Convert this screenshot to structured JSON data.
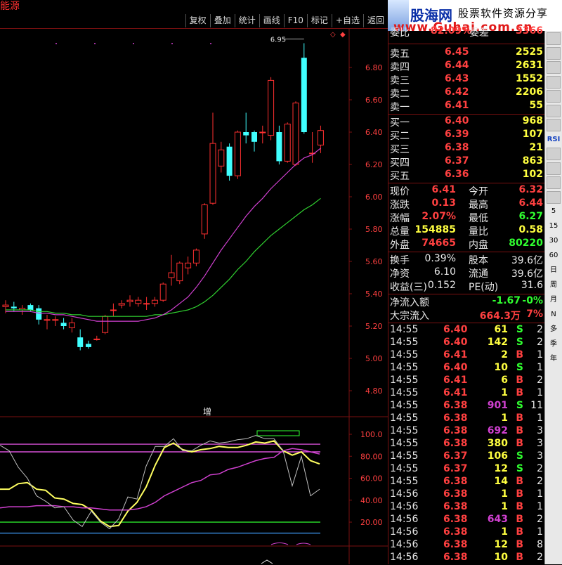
{
  "window": {
    "title": "能源"
  },
  "toolbar": [
    {
      "label": "复权"
    },
    {
      "label": "叠加"
    },
    {
      "label": "统计"
    },
    {
      "label": "画线"
    },
    {
      "label": "F10"
    },
    {
      "label": "标记"
    },
    {
      "label": "+自选"
    },
    {
      "label": "返回"
    }
  ],
  "ad": {
    "logo": "股海网",
    "slogan": "股票软件资源分享",
    "url": "www.Guhai.com.cn"
  },
  "main_chart": {
    "y_axis_ticks": [
      "6.80",
      "6.60",
      "6.40",
      "6.20",
      "6.00",
      "5.80",
      "5.60",
      "5.40",
      "5.20",
      "5.00",
      "4.80"
    ],
    "high_label": "6.95",
    "mark_label": "增",
    "up_color": "#ff3030",
    "down_color": "#40ffff",
    "ma_short_color": "#d040d0",
    "ma_long_color": "#30d030",
    "ma_mid_color": "#e8e8e8"
  },
  "indicator": {
    "y_axis_ticks": [
      "100.0",
      "80.00",
      "60.00",
      "40.00",
      "20.00"
    ]
  },
  "chart_data": [
    {
      "type": "candlestick",
      "title": "",
      "ylim": [
        4.7,
        7.0
      ],
      "candles": [
        {
          "o": 5.32,
          "h": 5.36,
          "l": 5.28,
          "c": 5.33
        },
        {
          "o": 5.32,
          "h": 5.35,
          "l": 5.29,
          "c": 5.31
        },
        {
          "o": 5.3,
          "h": 5.33,
          "l": 5.27,
          "c": 5.31
        },
        {
          "o": 5.33,
          "h": 5.34,
          "l": 5.29,
          "c": 5.3
        },
        {
          "o": 5.31,
          "h": 5.33,
          "l": 5.21,
          "c": 5.24
        },
        {
          "o": 5.24,
          "h": 5.27,
          "l": 5.18,
          "c": 5.24
        },
        {
          "o": 5.24,
          "h": 5.26,
          "l": 5.2,
          "c": 5.24
        },
        {
          "o": 5.22,
          "h": 5.25,
          "l": 5.18,
          "c": 5.2
        },
        {
          "o": 5.19,
          "h": 5.25,
          "l": 5.16,
          "c": 5.22
        },
        {
          "o": 5.13,
          "h": 5.18,
          "l": 5.05,
          "c": 5.07
        },
        {
          "o": 5.09,
          "h": 5.11,
          "l": 5.06,
          "c": 5.07
        },
        {
          "o": 5.12,
          "h": 5.14,
          "l": 5.11,
          "c": 5.12
        },
        {
          "o": 5.16,
          "h": 5.27,
          "l": 5.15,
          "c": 5.26
        },
        {
          "o": 5.3,
          "h": 5.34,
          "l": 5.26,
          "c": 5.3
        },
        {
          "o": 5.33,
          "h": 5.36,
          "l": 5.31,
          "c": 5.34
        },
        {
          "o": 5.35,
          "h": 5.39,
          "l": 5.32,
          "c": 5.36
        },
        {
          "o": 5.34,
          "h": 5.38,
          "l": 5.32,
          "c": 5.36
        },
        {
          "o": 5.34,
          "h": 5.38,
          "l": 5.3,
          "c": 5.34
        },
        {
          "o": 5.34,
          "h": 5.38,
          "l": 5.32,
          "c": 5.36
        },
        {
          "o": 5.36,
          "h": 5.47,
          "l": 5.35,
          "c": 5.46
        },
        {
          "o": 5.5,
          "h": 5.64,
          "l": 5.45,
          "c": 5.53
        },
        {
          "o": 5.48,
          "h": 5.6,
          "l": 5.46,
          "c": 5.59
        },
        {
          "o": 5.56,
          "h": 5.63,
          "l": 5.52,
          "c": 5.59
        },
        {
          "o": 5.59,
          "h": 5.68,
          "l": 5.57,
          "c": 5.67
        },
        {
          "o": 5.77,
          "h": 5.96,
          "l": 5.74,
          "c": 5.95
        },
        {
          "o": 5.96,
          "h": 6.52,
          "l": 5.95,
          "c": 6.33
        },
        {
          "o": 6.19,
          "h": 6.34,
          "l": 6.15,
          "c": 6.29
        },
        {
          "o": 6.31,
          "h": 6.33,
          "l": 6.1,
          "c": 6.13
        },
        {
          "o": 6.13,
          "h": 6.41,
          "l": 6.11,
          "c": 6.4
        },
        {
          "o": 6.4,
          "h": 6.52,
          "l": 6.33,
          "c": 6.38
        },
        {
          "o": 6.4,
          "h": 6.41,
          "l": 6.28,
          "c": 6.34
        },
        {
          "o": 6.4,
          "h": 6.44,
          "l": 6.33,
          "c": 6.4
        },
        {
          "o": 6.38,
          "h": 6.74,
          "l": 6.35,
          "c": 6.72
        },
        {
          "o": 6.4,
          "h": 6.44,
          "l": 6.2,
          "c": 6.22
        },
        {
          "o": 6.22,
          "h": 6.46,
          "l": 6.21,
          "c": 6.45
        },
        {
          "o": 6.2,
          "h": 6.59,
          "l": 6.19,
          "c": 6.58
        },
        {
          "o": 6.86,
          "h": 6.95,
          "l": 6.39,
          "c": 6.4
        },
        {
          "o": 6.27,
          "h": 6.4,
          "l": 6.21,
          "c": 6.27
        },
        {
          "o": 6.32,
          "h": 6.44,
          "l": 6.27,
          "c": 6.41
        }
      ],
      "ma_short": [
        5.29,
        5.29,
        5.29,
        5.29,
        5.28,
        5.28,
        5.27,
        5.27,
        5.26,
        5.25,
        5.24,
        5.23,
        5.23,
        5.23,
        5.23,
        5.23,
        5.23,
        5.24,
        5.25,
        5.27,
        5.3,
        5.34,
        5.38,
        5.44,
        5.51,
        5.59,
        5.67,
        5.74,
        5.81,
        5.88,
        5.94,
        5.99,
        6.05,
        6.1,
        6.15,
        6.2,
        6.24,
        6.26,
        6.3
      ],
      "ma_long": [
        5.3,
        5.3,
        5.3,
        5.3,
        5.29,
        5.29,
        5.28,
        5.28,
        5.27,
        5.27,
        5.26,
        5.26,
        5.26,
        5.26,
        5.26,
        5.26,
        5.26,
        5.26,
        5.27,
        5.27,
        5.28,
        5.29,
        5.3,
        5.32,
        5.35,
        5.39,
        5.44,
        5.49,
        5.55,
        5.6,
        5.66,
        5.71,
        5.76,
        5.8,
        5.84,
        5.88,
        5.92,
        5.95,
        5.99
      ]
    },
    {
      "type": "line",
      "title": "",
      "ylim": [
        0,
        115
      ],
      "hlines": [
        {
          "value": 91,
          "color": "#ff60ff"
        },
        {
          "value": 84,
          "color": "#ff60ff"
        },
        {
          "value": 20,
          "color": "#30ff30"
        },
        {
          "value": 10,
          "color": "#40a0ff"
        }
      ],
      "series": [
        {
          "color": "#ffff60",
          "width": 2,
          "values": [
            50,
            50,
            55,
            56,
            50,
            49,
            42,
            41,
            37,
            36,
            31,
            21,
            16,
            17,
            30,
            38,
            52,
            72,
            88,
            92,
            86,
            84,
            86,
            87,
            89,
            88,
            88,
            90,
            93,
            92,
            94,
            85,
            81,
            84,
            76,
            73
          ]
        },
        {
          "color": "#d040d0",
          "width": 1.5,
          "values": [
            33,
            34,
            34,
            34,
            35,
            35,
            35,
            34,
            34,
            33,
            33,
            32,
            31,
            31,
            31,
            32,
            34,
            38,
            44,
            48,
            52,
            56,
            58,
            63,
            64,
            68,
            70,
            73,
            76,
            78,
            79,
            85,
            87,
            86,
            84,
            82
          ]
        },
        {
          "color": "#c0c0c0",
          "width": 1,
          "values": [
            90,
            85,
            70,
            60,
            44,
            39,
            33,
            34,
            22,
            16,
            30,
            20,
            14,
            23,
            43,
            41,
            71,
            89,
            89,
            96,
            85,
            85,
            90,
            94,
            92,
            93,
            95,
            96,
            99,
            96,
            96,
            85,
            53,
            80,
            44,
            50
          ]
        }
      ]
    }
  ],
  "order_book": {
    "header": {
      "label": "委比",
      "value": "82.09%",
      "label2": "委差",
      "value2": "3366"
    },
    "asks": [
      {
        "label": "卖五",
        "price": "6.45",
        "vol": "2525"
      },
      {
        "label": "卖四",
        "price": "6.44",
        "vol": "2631"
      },
      {
        "label": "卖三",
        "price": "6.43",
        "vol": "1552"
      },
      {
        "label": "卖二",
        "price": "6.42",
        "vol": "2206"
      },
      {
        "label": "卖一",
        "price": "6.41",
        "vol": "55"
      }
    ],
    "bids": [
      {
        "label": "买一",
        "price": "6.40",
        "vol": "968"
      },
      {
        "label": "买二",
        "price": "6.39",
        "vol": "107"
      },
      {
        "label": "买三",
        "price": "6.38",
        "vol": "21"
      },
      {
        "label": "买四",
        "price": "6.37",
        "vol": "863"
      },
      {
        "label": "买五",
        "price": "6.36",
        "vol": "102"
      }
    ]
  },
  "stats": [
    {
      "l1": "现价",
      "v1": "6.41",
      "c1": "red",
      "l2": "今开",
      "v2": "6.32",
      "c2": "red"
    },
    {
      "l1": "涨跌",
      "v1": "0.13",
      "c1": "red",
      "l2": "最高",
      "v2": "6.44",
      "c2": "red"
    },
    {
      "l1": "涨幅",
      "v1": "2.07%",
      "c1": "red",
      "l2": "最低",
      "v2": "6.27",
      "c2": "green"
    },
    {
      "l1": "总量",
      "v1": "154885",
      "c1": "vol",
      "l2": "量比",
      "v2": "0.58",
      "c2": "vol"
    },
    {
      "l1": "外盘",
      "v1": "74665",
      "c1": "red",
      "l2": "内盘",
      "v2": "80220",
      "c2": "green"
    }
  ],
  "stats2": [
    {
      "l1": "换手",
      "v1": "0.39%",
      "l2": "股本",
      "v2": "39.6亿"
    },
    {
      "l1": "净资",
      "v1": "6.10",
      "l2": "流通",
      "v2": "39.6亿"
    },
    {
      "l1": "收益(三)",
      "v1": "0.152",
      "l2": "PE(动)",
      "v2": "31.6"
    }
  ],
  "flows": [
    {
      "label": "净流入额",
      "v1": "-1.67",
      "v2": "-0%",
      "c": "green"
    },
    {
      "label": "大宗流入",
      "v1": "664.3万",
      "v2": "7%",
      "c": "red"
    }
  ],
  "ticks": [
    {
      "t": "14:55",
      "p": "6.40",
      "v": "61",
      "vc": "vol",
      "bs": "S",
      "n": "2"
    },
    {
      "t": "14:55",
      "p": "6.40",
      "v": "142",
      "vc": "vol",
      "bs": "S",
      "n": "2"
    },
    {
      "t": "14:55",
      "p": "6.41",
      "v": "2",
      "vc": "vol",
      "bs": "B",
      "n": "1"
    },
    {
      "t": "14:55",
      "p": "6.40",
      "v": "10",
      "vc": "vol",
      "bs": "S",
      "n": "1"
    },
    {
      "t": "14:55",
      "p": "6.41",
      "v": "6",
      "vc": "vol",
      "bs": "B",
      "n": "2"
    },
    {
      "t": "14:55",
      "p": "6.41",
      "v": "1",
      "vc": "vol",
      "bs": "B",
      "n": "1"
    },
    {
      "t": "14:55",
      "p": "6.38",
      "v": "901",
      "vc": "purple",
      "bs": "S",
      "n": "11"
    },
    {
      "t": "14:55",
      "p": "6.38",
      "v": "1",
      "vc": "vol",
      "bs": "B",
      "n": "1"
    },
    {
      "t": "14:55",
      "p": "6.38",
      "v": "692",
      "vc": "purple",
      "bs": "B",
      "n": "3"
    },
    {
      "t": "14:55",
      "p": "6.38",
      "v": "380",
      "vc": "vol",
      "bs": "B",
      "n": "3"
    },
    {
      "t": "14:55",
      "p": "6.37",
      "v": "106",
      "vc": "vol",
      "bs": "S",
      "n": "3"
    },
    {
      "t": "14:55",
      "p": "6.37",
      "v": "12",
      "vc": "vol",
      "bs": "S",
      "n": "2"
    },
    {
      "t": "14:55",
      "p": "6.38",
      "v": "14",
      "vc": "vol",
      "bs": "B",
      "n": "2"
    },
    {
      "t": "14:56",
      "p": "6.38",
      "v": "1",
      "vc": "vol",
      "bs": "B",
      "n": "1"
    },
    {
      "t": "14:56",
      "p": "6.38",
      "v": "1",
      "vc": "vol",
      "bs": "B",
      "n": "1"
    },
    {
      "t": "14:56",
      "p": "6.38",
      "v": "643",
      "vc": "purple",
      "bs": "B",
      "n": "2"
    },
    {
      "t": "14:56",
      "p": "6.38",
      "v": "1",
      "vc": "vol",
      "bs": "B",
      "n": "1"
    },
    {
      "t": "14:56",
      "p": "6.38",
      "v": "12",
      "vc": "vol",
      "bs": "B",
      "n": "8"
    },
    {
      "t": "14:56",
      "p": "6.38",
      "v": "10",
      "vc": "vol",
      "bs": "B",
      "n": "2"
    }
  ],
  "sidebar": {
    "items": [
      {
        "label": "",
        "icon": "grid-icon"
      },
      {
        "label": "",
        "icon": "chart-icon"
      },
      {
        "label": "",
        "icon": "table-icon"
      },
      {
        "label": "",
        "icon": "list-icon"
      },
      {
        "label": "",
        "icon": "news-icon"
      },
      {
        "label": "",
        "icon": "f10-icon"
      },
      {
        "label": "",
        "icon": "zoom-icon"
      },
      {
        "label": "RSI",
        "icon": "rsi-icon"
      },
      {
        "label": "",
        "icon": "move-icon"
      },
      {
        "label": "",
        "icon": "draw-icon"
      },
      {
        "label": "",
        "icon": "fs-icon"
      },
      {
        "label": "",
        "icon": "sort-icon"
      },
      {
        "label": "5",
        "icon": ""
      },
      {
        "label": "15",
        "icon": ""
      },
      {
        "label": "30",
        "icon": ""
      },
      {
        "label": "60",
        "icon": ""
      },
      {
        "label": "日",
        "icon": ""
      },
      {
        "label": "周",
        "icon": ""
      },
      {
        "label": "月",
        "icon": ""
      },
      {
        "label": "N",
        "icon": ""
      },
      {
        "label": "多",
        "icon": ""
      },
      {
        "label": "季",
        "icon": ""
      },
      {
        "label": "年",
        "icon": ""
      }
    ]
  }
}
